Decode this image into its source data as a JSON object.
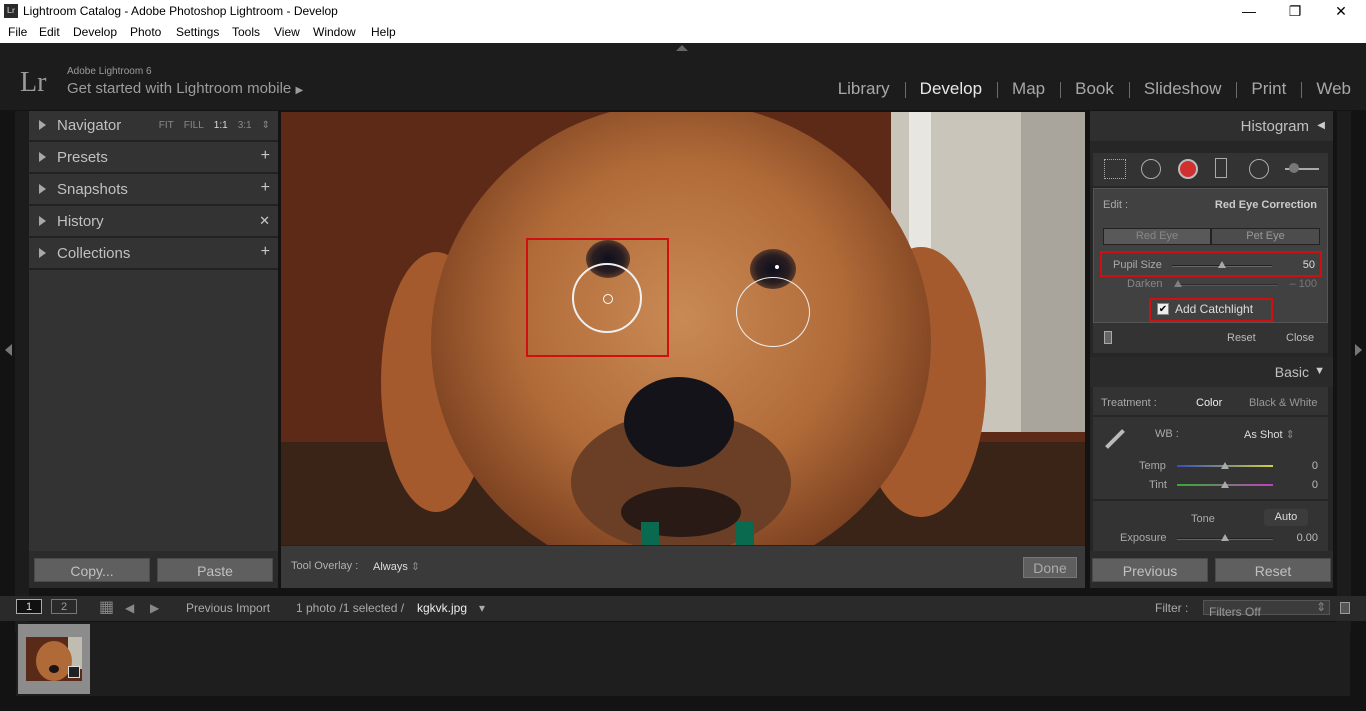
{
  "window": {
    "title": "Lightroom Catalog - Adobe Photoshop Lightroom - Develop",
    "app_badge": "Lr",
    "minimize": "—",
    "restore": "❐",
    "close": "✕"
  },
  "menu": [
    "File",
    "Edit",
    "Develop",
    "Photo",
    "Settings",
    "Tools",
    "View",
    "Window",
    "Help"
  ],
  "identity": {
    "logo": "Lr",
    "product": "Adobe Lightroom 6",
    "mobile": "Get started with Lightroom mobile",
    "mobile_arrow": "▶"
  },
  "modules": [
    "Library",
    "Develop",
    "Map",
    "Book",
    "Slideshow",
    "Print",
    "Web"
  ],
  "active_module": "Develop",
  "left_panel": {
    "navigator": {
      "label": "Navigator",
      "options": [
        "FIT",
        "FILL",
        "1:1",
        "3:1"
      ],
      "active": "1:1",
      "stepper": "⇕"
    },
    "presets": {
      "label": "Presets",
      "action": "+"
    },
    "snapshots": {
      "label": "Snapshots",
      "action": "+"
    },
    "history": {
      "label": "History",
      "action": "✕"
    },
    "collections": {
      "label": "Collections",
      "action": "+"
    },
    "copy": "Copy...",
    "paste": "Paste"
  },
  "toolbar": {
    "overlay_label": "Tool Overlay :",
    "overlay_value": "Always",
    "overlay_arrow": "⇕",
    "done": "Done"
  },
  "right_panel": {
    "histogram_title": "Histogram",
    "histogram_arrow": "◀",
    "edit": {
      "label": "Edit :",
      "mode": "Red Eye Correction",
      "tabs": [
        "Red Eye",
        "Pet Eye"
      ],
      "pupil_label": "Pupil Size",
      "pupil_value": "50",
      "pupil_level_pct": 50,
      "darken_label": "Darken",
      "darken_value": "– 100",
      "darken_level_pct": 0,
      "catchlight_check": "✔",
      "catchlight_label": "Add Catchlight",
      "reset": "Reset",
      "close": "Close"
    },
    "basic": {
      "title": "Basic",
      "arrow": "▼",
      "treatment_label": "Treatment :",
      "treatment_color": "Color",
      "treatment_bw": "Black & White",
      "wb_label": "WB :",
      "wb_value": "As Shot",
      "wb_arrow": "⇕",
      "temp_label": "Temp",
      "temp_value": "0",
      "tint_label": "Tint",
      "tint_value": "0",
      "tone_label": "Tone",
      "auto": "Auto",
      "exposure_label": "Exposure",
      "exposure_value": "0.00"
    },
    "previous": "Previous",
    "reset": "Reset"
  },
  "filmbar": {
    "view1": "1",
    "view2": "2",
    "grid_icon": "▦",
    "back": "◀",
    "forward": "▶",
    "source": "Previous Import",
    "count": "1 photo /1 selected /",
    "filename": "kgkvk.jpg",
    "filename_arrow": "▾",
    "filter_label": "Filter :",
    "filter_value": "Filters Off",
    "filter_arrow": "⇕"
  },
  "colors": {
    "highlight_red": "#d01010",
    "panel_bg": "#333333",
    "app_bg": "#131313"
  }
}
